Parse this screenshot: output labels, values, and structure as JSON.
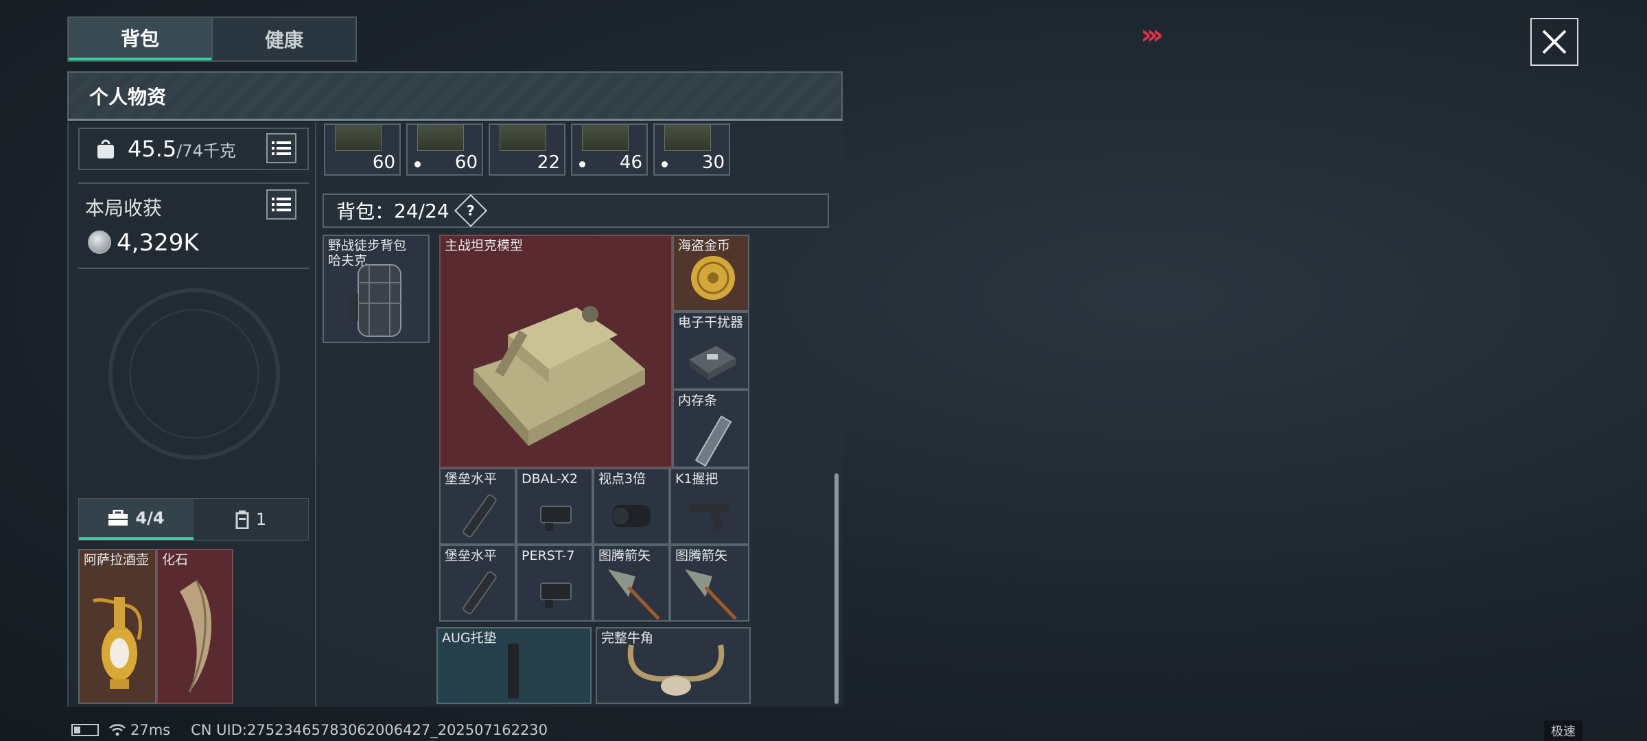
{
  "tabs": [
    {
      "label": "背包",
      "active": true
    },
    {
      "label": "健康",
      "active": false
    }
  ],
  "panel_title": "个人物资",
  "weight": {
    "current": "45.5",
    "max": "/74千克"
  },
  "harvest": {
    "label": "本局收获",
    "value": "4,329K"
  },
  "sub_tabs": [
    {
      "label": "4/4",
      "icon": "toolbox-icon"
    },
    {
      "label": "1",
      "icon": "container-icon"
    }
  ],
  "pocket_items": [
    {
      "name": "阿萨拉酒壶"
    },
    {
      "name": "化石"
    }
  ],
  "ammo": [
    {
      "count": "60",
      "dot": false
    },
    {
      "count": "60",
      "dot": true
    },
    {
      "count": "22",
      "dot": false
    },
    {
      "count": "46",
      "dot": true
    },
    {
      "count": "30",
      "dot": true
    }
  ],
  "backpack": {
    "label": "背包：",
    "value": "24/24",
    "help": "?"
  },
  "equipped_bag": {
    "name": "野战徒步背包",
    "sub": "哈夫克"
  },
  "items": {
    "tank": "主战坦克模型",
    "coin": "海盗金币",
    "jammer": "电子干扰器",
    "ram": "内存条",
    "r1": [
      "堡垒水平",
      "DBAL-X2",
      "视点3倍",
      "K1握把"
    ],
    "r2": [
      "堡垒水平",
      "PERST-7",
      "图腾箭矢",
      "图腾箭矢"
    ],
    "aug": "AUG托垫",
    "horn": "完整牛角"
  },
  "status": {
    "ping": "27ms",
    "uid": "CN UID:27523465783062006427_202507162230",
    "mode": "极速"
  },
  "colors": {
    "accent": "#2fd39b",
    "alert": "#e0334a",
    "legendary_bg": "#5a2a31"
  }
}
